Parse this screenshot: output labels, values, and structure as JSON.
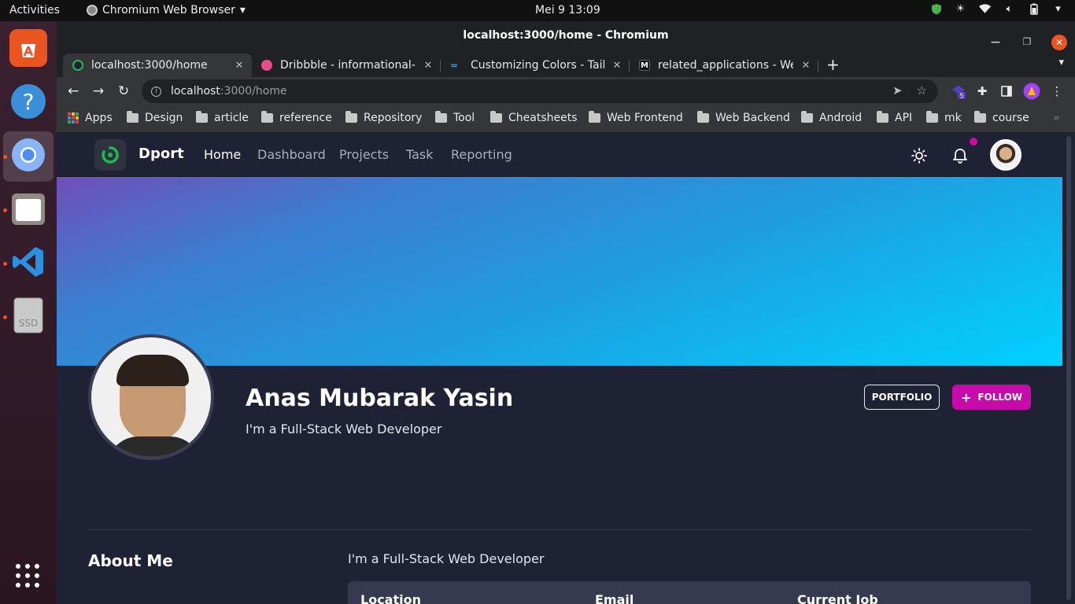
{
  "os": {
    "activities": "Activities",
    "app_menu": "Chromium Web Browser",
    "clock": "Mei 9  13:09",
    "battery_caret": "▾"
  },
  "window": {
    "title": "localhost:3000/home - Chromium"
  },
  "tabs": [
    {
      "title": "localhost:3000/home",
      "favicon_color": "#1db954"
    },
    {
      "title": "Dribbble - informational-p",
      "favicon_color": "#ea4c89"
    },
    {
      "title": "Customizing Colors - Tailw",
      "favicon_color": "#38bdf8"
    },
    {
      "title": "related_applications - We",
      "favicon_color": "#111111"
    }
  ],
  "address": {
    "host": "localhost",
    "path": ":3000/home"
  },
  "extensions": {
    "badge": "5"
  },
  "bookmarks": [
    "Apps",
    "Design",
    "article",
    "reference",
    "Repository",
    "Tool",
    "Cheatsheets",
    "Web Frontend",
    "Web Backend",
    "Android",
    "API",
    "mk",
    "course"
  ],
  "site": {
    "brand": "Dport",
    "nav": [
      "Home",
      "Dashboard",
      "Projects",
      "Task",
      "Reporting"
    ],
    "active_nav": "Home",
    "accent": "#c70aaa"
  },
  "profile": {
    "name": "Anas Mubarak Yasin",
    "tagline": "I'm a Full-Stack Web Developer",
    "portfolio_label": "PORTFOLIO",
    "follow_label": "FOLLOW"
  },
  "about": {
    "heading": "About Me",
    "text": "I'm a Full-Stack Web Developer",
    "columns": [
      "Location",
      "Email",
      "Current Job"
    ]
  }
}
